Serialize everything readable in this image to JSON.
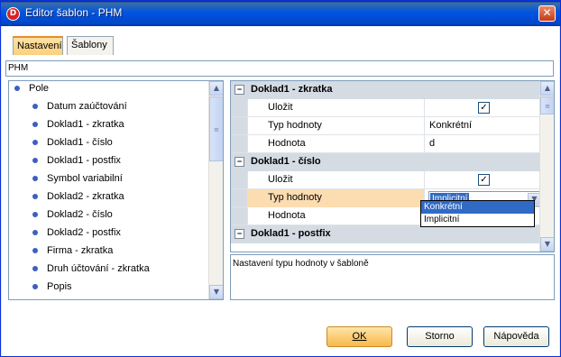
{
  "window": {
    "title": "Editor šablon - PHM",
    "app_icon_letter": "D",
    "close_glyph": "✕"
  },
  "tabs": [
    {
      "label": "Nastavení",
      "active": true
    },
    {
      "label": "Šablony",
      "active": false
    }
  ],
  "template_name": "PHM",
  "tree": {
    "root": "Pole",
    "items": [
      "Datum zaúčtování",
      "Doklad1 - zkratka",
      "Doklad1 - číslo",
      "Doklad1 - postfix",
      "Symbol variabilní",
      "Doklad2 - zkratka",
      "Doklad2 - číslo",
      "Doklad2 - postfix",
      "Firma - zkratka",
      "Druh účtování - zkratka",
      "Popis"
    ]
  },
  "property_grid": {
    "categories": [
      {
        "label": "Doklad1 - zkratka",
        "expander": "−",
        "rows": [
          {
            "name": "Uložit",
            "value_type": "checkbox",
            "checked": true
          },
          {
            "name": "Typ hodnoty",
            "value": "Konkrétní"
          },
          {
            "name": "Hodnota",
            "value": "d"
          }
        ]
      },
      {
        "label": "Doklad1 - číslo",
        "expander": "−",
        "rows": [
          {
            "name": "Uložit",
            "value_type": "checkbox",
            "checked": true
          },
          {
            "name": "Typ hodnoty",
            "value": "Implicitní",
            "selected": true
          },
          {
            "name": "Hodnota",
            "value": ""
          }
        ]
      },
      {
        "label": "Doklad1 - postfix",
        "expander": "−",
        "rows": []
      }
    ],
    "dropdown_options": [
      "Konkrétní",
      "Implicitní"
    ],
    "dropdown_highlighted": "Konkrétní",
    "check_glyph": "✓"
  },
  "description": "Nastavení typu hodnoty v šabloně",
  "buttons": {
    "ok": "OK",
    "storno": "Storno",
    "napoveda": "Nápověda"
  },
  "colors": {
    "accent_orange": "#f9b84a",
    "selection_blue": "#316ac5",
    "category_gray": "#d4dbe3"
  }
}
